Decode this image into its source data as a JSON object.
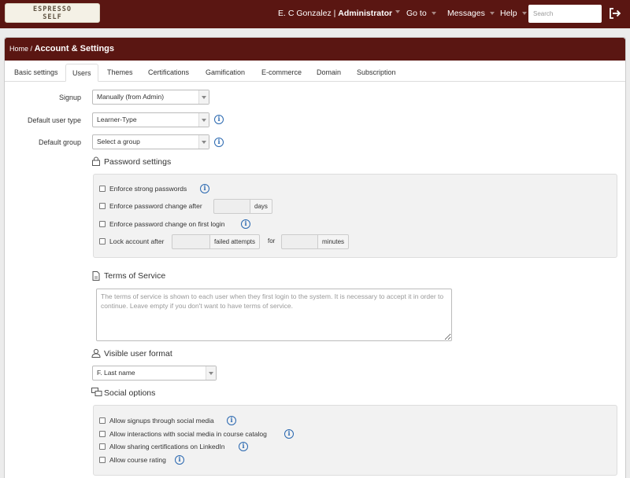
{
  "app": {
    "logo_line1": "ESPRESSO",
    "logo_line2": "SELF"
  },
  "topbar": {
    "user_name": "E. C Gonzalez",
    "separator": "|",
    "role": "Administrator",
    "nav": [
      {
        "label": "Go to"
      },
      {
        "label": "Messages"
      },
      {
        "label": "Help"
      }
    ],
    "search_placeholder": "Search"
  },
  "breadcrumb": {
    "home": "Home",
    "separator": "/",
    "title": "Account & Settings"
  },
  "tabs": [
    {
      "label": "Basic settings",
      "active": false
    },
    {
      "label": "Users",
      "active": true
    },
    {
      "label": "Themes",
      "active": false
    },
    {
      "label": "Certifications",
      "active": false
    },
    {
      "label": "Gamification",
      "active": false
    },
    {
      "label": "E-commerce",
      "active": false
    },
    {
      "label": "Domain",
      "active": false
    },
    {
      "label": "Subscription",
      "active": false
    }
  ],
  "form": {
    "signup": {
      "label": "Signup",
      "value": "Manually (from Admin)"
    },
    "default_user_type": {
      "label": "Default user type",
      "value": "Learner-Type"
    },
    "default_group": {
      "label": "Default group",
      "value": "Select a group"
    }
  },
  "password_settings": {
    "title": "Password settings",
    "enforce_strong": "Enforce strong passwords",
    "enforce_change_after": "Enforce password change after",
    "days_addon": "days",
    "enforce_change_first_login": "Enforce password change on first login",
    "lock_account_after": "Lock account after",
    "failed_attempts_addon": "failed attempts",
    "for_text": "for",
    "minutes_addon": "minutes"
  },
  "terms_of_service": {
    "title": "Terms of Service",
    "placeholder": "The terms of service is shown to each user when they first login to the system. It is necessary to accept it in order to continue. Leave empty if you don't want to have terms of service."
  },
  "visible_user_format": {
    "title": "Visible user format",
    "value": "F. Last name"
  },
  "social_options": {
    "title": "Social options",
    "items": [
      {
        "label": "Allow signups through social media"
      },
      {
        "label": "Allow interactions with social media in course catalog"
      },
      {
        "label": "Allow sharing certifications on LinkedIn"
      },
      {
        "label": "Allow course rating"
      }
    ]
  },
  "colors": {
    "header_bg": "#5a1612",
    "info_blue": "#2a68b0",
    "well_bg": "#f2f2f2"
  },
  "icons": {
    "info": "info-circle-icon",
    "lock": "lock-icon",
    "document": "document-icon",
    "user": "user-icon",
    "chat": "chat-bubbles-icon",
    "logout": "logout-icon"
  }
}
